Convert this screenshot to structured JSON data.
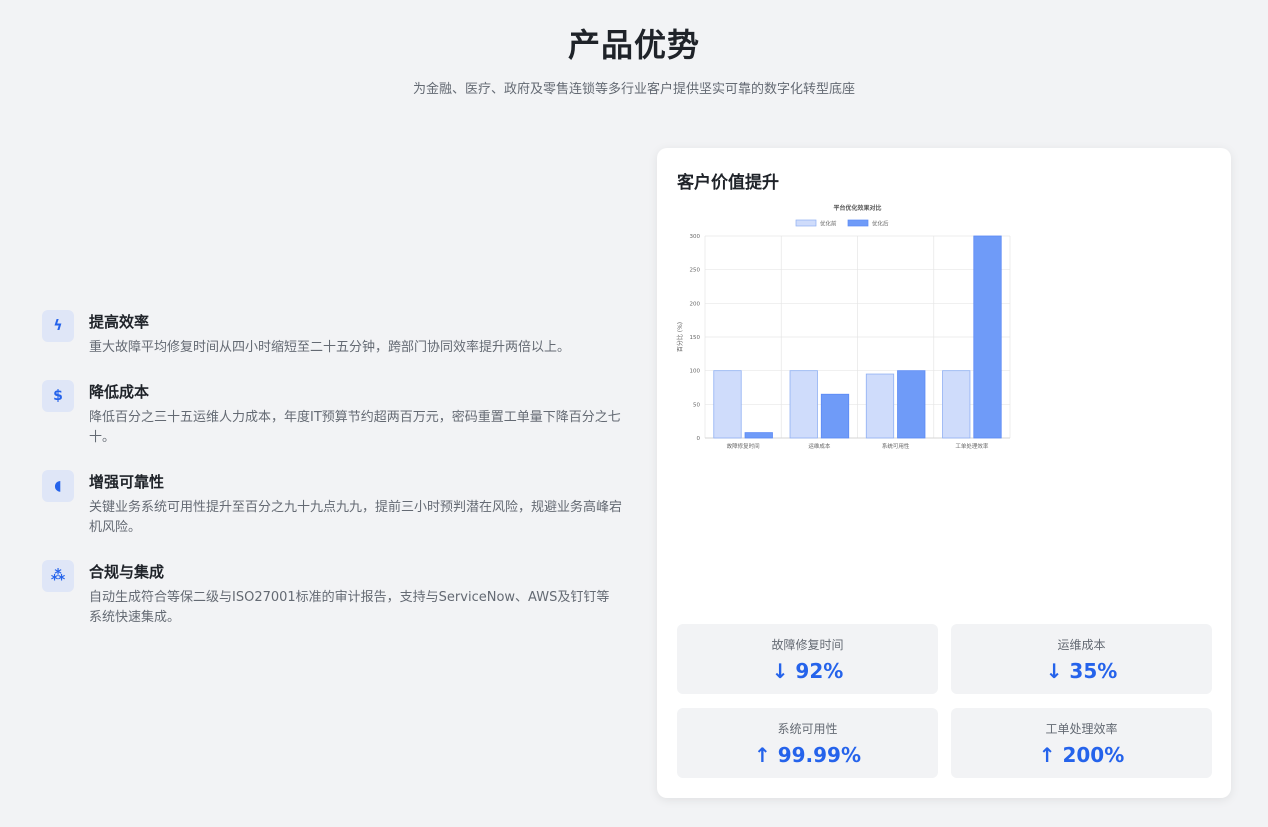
{
  "header": {
    "title": "产品优势",
    "subtitle": "为金融、医疗、政府及零售连锁等多行业客户提供坚实可靠的数字化转型底座"
  },
  "features": [
    {
      "icon": "lightning-icon",
      "glyph": "ϟ",
      "title": "提高效率",
      "desc": "重大故障平均修复时间从四小时缩短至二十五分钟，跨部门协同效率提升两倍以上。"
    },
    {
      "icon": "dollar-icon",
      "glyph": "$",
      "title": "降低成本",
      "desc": "降低百分之三十五运维人力成本，年度IT预算节约超两百万元，密码重置工单量下降百分之七十。"
    },
    {
      "icon": "shield-icon",
      "glyph": "◖",
      "title": "增强可靠性",
      "desc": "关键业务系统可用性提升至百分之九十九点九九，提前三小时预判潜在风险，规避业务高峰宕机风险。"
    },
    {
      "icon": "sitemap-icon",
      "glyph": "⁂",
      "title": "合规与集成",
      "desc": "自动生成符合等保二级与ISO27001标准的审计报告，支持与ServiceNow、AWS及钉钉等系统快速集成。"
    }
  ],
  "card": {
    "title": "客户价值提升"
  },
  "chart_data": {
    "type": "bar",
    "title": "平台优化效果对比",
    "categories": [
      "故障修复时间",
      "运维成本",
      "系统可用性",
      "工单处理效率"
    ],
    "series": [
      {
        "name": "优化前",
        "values": [
          100,
          100,
          95,
          100
        ],
        "color": "#cfdcfb",
        "stroke": "#8fb0f3"
      },
      {
        "name": "优化后",
        "values": [
          8,
          65,
          100,
          300
        ],
        "color": "#6f9bf8",
        "stroke": "#5b8af5"
      }
    ],
    "ylabel": "百分比 (%)",
    "ylim": [
      0,
      300
    ],
    "yticks": [
      0,
      50,
      100,
      150,
      200,
      250,
      300
    ],
    "grid": true,
    "legend": "top"
  },
  "stats": [
    {
      "label": "故障修复时间",
      "value": "↓ 92%"
    },
    {
      "label": "运维成本",
      "value": "↓ 35%"
    },
    {
      "label": "系统可用性",
      "value": "↑ 99.99%"
    },
    {
      "label": "工单处理效率",
      "value": "↑ 200%"
    }
  ],
  "colors": {
    "accent": "#2563eb",
    "background": "#f2f3f5",
    "icon_bg": "#dfe6f7"
  }
}
